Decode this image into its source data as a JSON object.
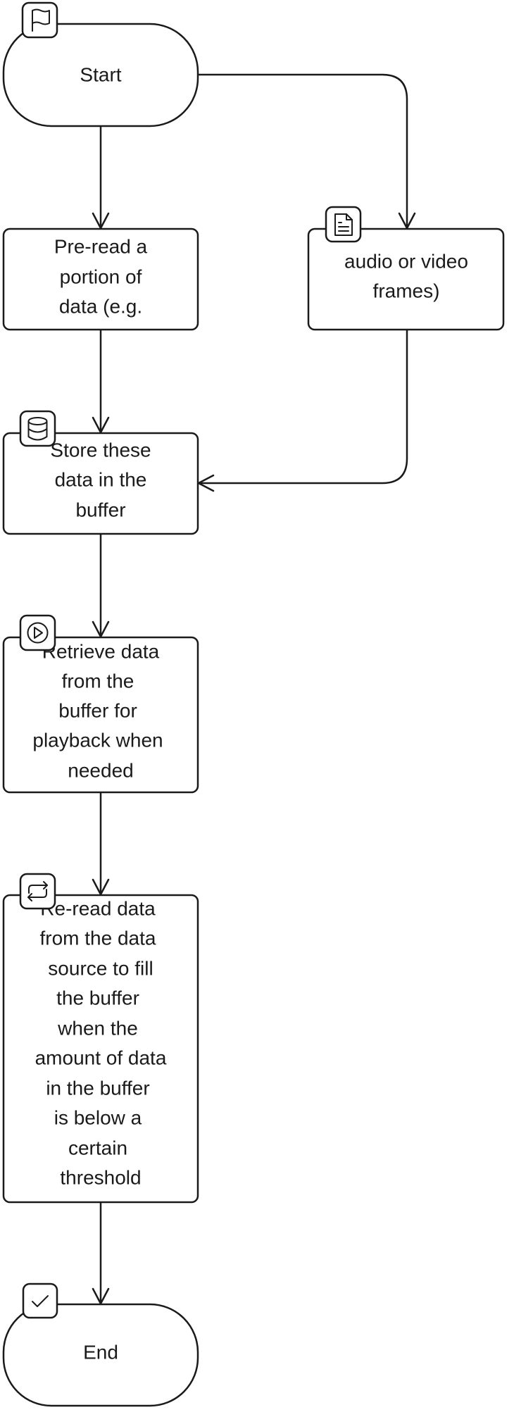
{
  "diagram": {
    "type": "flowchart",
    "colors": {
      "stroke": "#1a1a1a",
      "background": "#ffffff"
    },
    "nodes": [
      {
        "id": "start",
        "shape": "terminal",
        "icon": "flag-icon",
        "lines": [
          "Start"
        ]
      },
      {
        "id": "preread",
        "shape": "process",
        "lines": [
          "Pre-read a",
          "portion of",
          "data (e.g."
        ]
      },
      {
        "id": "audio",
        "shape": "process",
        "icon": "document-icon",
        "lines": [
          "audio or video",
          "frames)"
        ]
      },
      {
        "id": "store",
        "shape": "process",
        "icon": "database-icon",
        "lines": [
          "Store these",
          "data in the",
          "buffer"
        ]
      },
      {
        "id": "retrieve",
        "shape": "process",
        "icon": "play-icon",
        "lines": [
          "Retrieve data",
          "from the",
          "buffer for",
          "playback when",
          "needed"
        ]
      },
      {
        "id": "reread",
        "shape": "process",
        "icon": "repeat-icon",
        "lines": [
          "Re-read data",
          "from the data",
          "source to fill",
          "the buffer",
          "when the",
          "amount of data",
          "in the buffer",
          "is below a",
          "certain",
          "threshold"
        ]
      },
      {
        "id": "end",
        "shape": "terminal",
        "icon": "check-icon",
        "lines": [
          "End"
        ]
      }
    ],
    "edges": [
      {
        "from": "start",
        "to": "preread"
      },
      {
        "from": "start",
        "to": "audio"
      },
      {
        "from": "preread",
        "to": "store"
      },
      {
        "from": "audio",
        "to": "store"
      },
      {
        "from": "store",
        "to": "retrieve"
      },
      {
        "from": "retrieve",
        "to": "reread"
      },
      {
        "from": "reread",
        "to": "end"
      }
    ]
  }
}
